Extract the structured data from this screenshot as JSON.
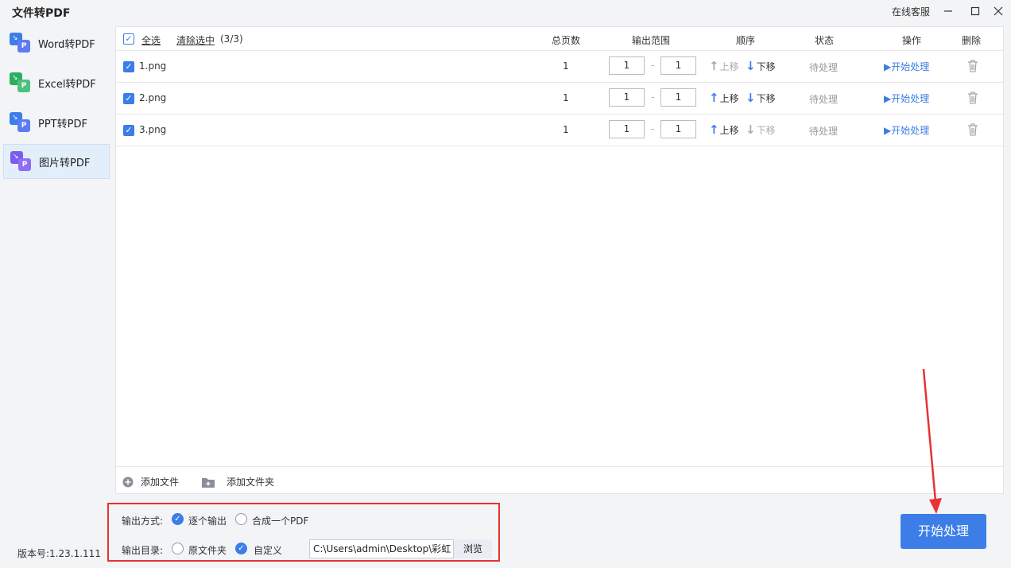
{
  "app": {
    "title": "文件转PDF",
    "support": "在线客服",
    "version": "版本号:1.23.1.111"
  },
  "sidebar": {
    "items": [
      {
        "label": "Word转PDF",
        "color": "#3c7de8"
      },
      {
        "label": "Excel转PDF",
        "color": "#2eae62"
      },
      {
        "label": "PPT转PDF",
        "color": "#3c7de8"
      },
      {
        "label": "图片转PDF",
        "color": "#7b5cf0",
        "active": true
      }
    ]
  },
  "table": {
    "select_all": "全选",
    "clear_selection": "清除选中",
    "selection_count": "(3/3)",
    "headers": {
      "pages": "总页数",
      "range": "输出范围",
      "order": "顺序",
      "status": "状态",
      "action": "操作",
      "delete": "删除"
    },
    "rows": [
      {
        "name": "1.png",
        "pages": "1",
        "from": "1",
        "to": "1",
        "up": "上移",
        "down": "下移",
        "status": "待处理",
        "action": "开始处理"
      },
      {
        "name": "2.png",
        "pages": "1",
        "from": "1",
        "to": "1",
        "up": "上移",
        "down": "下移",
        "status": "待处理",
        "action": "开始处理"
      },
      {
        "name": "3.png",
        "pages": "1",
        "from": "1",
        "to": "1",
        "up": "上移",
        "down": "下移",
        "status": "待处理",
        "action": "开始处理"
      }
    ],
    "add_file": "添加文件",
    "add_folder": "添加文件夹"
  },
  "options": {
    "output_mode_label": "输出方式:",
    "mode_each": "逐个输出",
    "mode_merge": "合成一个PDF",
    "output_dir_label": "输出目录:",
    "dir_original": "原文件夹",
    "dir_custom": "自定义",
    "path": "C:\\Users\\admin\\Desktop\\彩虹",
    "browse": "浏览"
  },
  "start_button": "开始处理",
  "colors": {
    "accent": "#3c7de8",
    "highlight": "#e63333"
  }
}
